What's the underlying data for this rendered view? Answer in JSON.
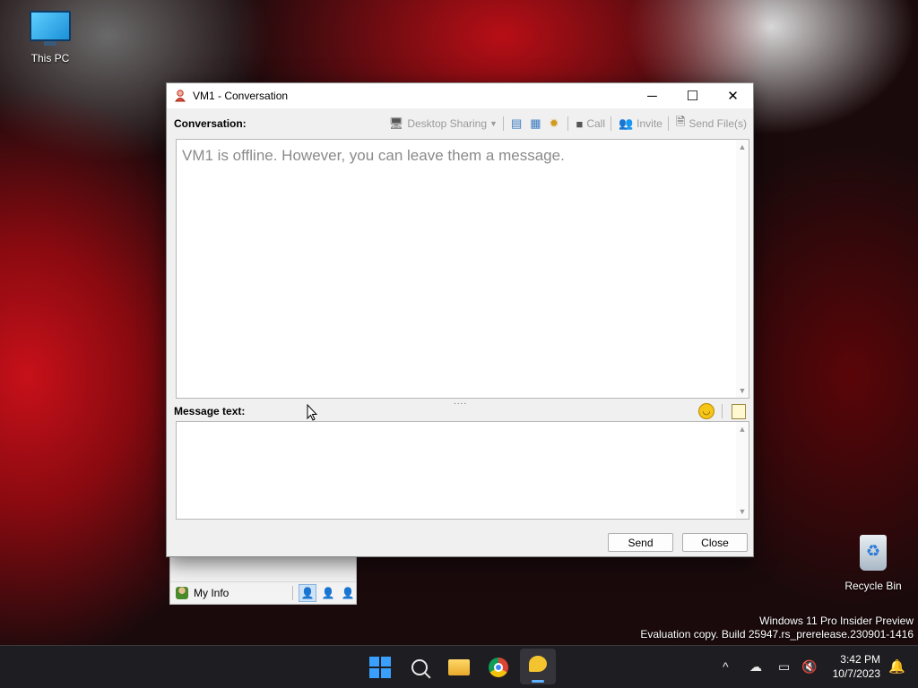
{
  "desktop": {
    "this_pc_label": "This PC",
    "recycle_bin_label": "Recycle Bin",
    "watermark_line1": "Windows 11 Pro Insider Preview",
    "watermark_line2": "Evaluation copy. Build 25947.rs_prerelease.230901-1416"
  },
  "window": {
    "title": "VM1 - Conversation",
    "controls": {
      "minimize": "─",
      "maximize": "☐",
      "close": "✕"
    },
    "conversation_label": "Conversation:",
    "toolbar": {
      "desktop_sharing": "Desktop Sharing",
      "call": "Call",
      "invite": "Invite",
      "send_files": "Send File(s)"
    },
    "conversation_text": "VM1 is offline. However, you can leave them a message.",
    "message_label": "Message text:",
    "message_value": "",
    "splitter": "....",
    "send_label": "Send",
    "close_label": "Close"
  },
  "contact_list": {
    "my_info_label": "My Info"
  },
  "taskbar": {
    "time": "3:42 PM",
    "date": "10/7/2023",
    "tray_chevron": "^"
  },
  "colors": {
    "accent": "#3aa0ff",
    "taskbar_bg": "#1e1e22",
    "disabled_text": "#9a9a9a"
  }
}
